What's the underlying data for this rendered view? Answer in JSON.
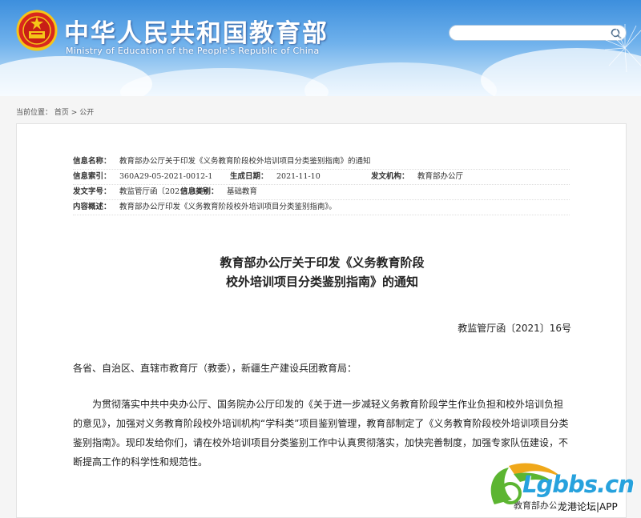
{
  "header": {
    "title": "中华人民共和国教育部",
    "subtitle": "Ministry of Education of the People's Republic of China",
    "search_placeholder": ""
  },
  "breadcrumb": {
    "prefix": "当前位置：",
    "home": "首页",
    "sep": " > ",
    "current": "公开"
  },
  "info": {
    "name_label": "信息名称：",
    "name_value": "教育部办公厅关于印发《义务教育阶段校外培训项目分类鉴别指南》的通知",
    "index_label": "信息索引：",
    "index_value": "360A29-05-2021-0012-1",
    "date_label": "生成日期：",
    "date_value": "2021-11-10",
    "issuer_label": "发文机构：",
    "issuer_value": "教育部办公厅",
    "docno_label": "发文字号：",
    "docno_value": "教监管厅函〔2021〕16号",
    "category_label": "信息类别：",
    "category_value": "基础教育",
    "summary_label": "内容概述：",
    "summary_value": "教育部办公厅印发《义务教育阶段校外培训项目分类鉴别指南》。"
  },
  "document": {
    "title_line1": "教育部办公厅关于印发《义务教育阶段",
    "title_line2": "校外培训项目分类鉴别指南》的通知",
    "number": "教监管厅函〔2021〕16号",
    "addressee": "各省、自治区、直辖市教育厅（教委），新疆生产建设兵团教育局：",
    "paragraph1": "为贯彻落实中共中央办公厅、国务院办公厅印发的《关于进一步减轻义务教育阶段学生作业负担和校外培训负担的意见》，加强对义务教育阶段校外培训机构“学科类”项目鉴别管理，教育部制定了《义务教育阶段校外培训项目分类鉴别指南》。现印发给你们，请在校外培训项目分类鉴别工作中认真贯彻落实，加快完善制度，加强专家队伍建设，不断提高工作的科学性和规范性。",
    "signoff": "教育部办公厅"
  },
  "watermark": {
    "brand": "Lgbbs.cn",
    "caption": "龙港论坛|APP"
  },
  "colors": {
    "banner_top": "#3d8fdd",
    "banner_bottom": "#dbeeff",
    "watermark_blue": "#27a2dd",
    "watermark_green": "#5cb531"
  }
}
